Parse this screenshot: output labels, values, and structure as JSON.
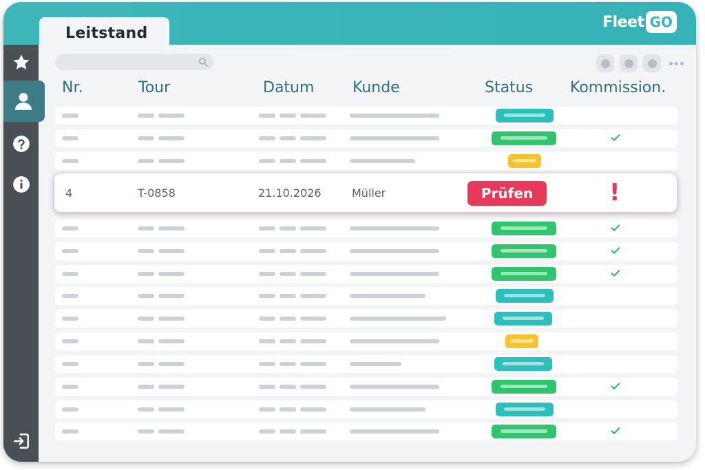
{
  "tab": {
    "label": "Leitstand"
  },
  "logo": {
    "text": "Fleet",
    "badge": "GO"
  },
  "sidebar": {
    "items": [
      {
        "name": "star-icon",
        "active": false
      },
      {
        "name": "user-icon",
        "active": true
      },
      {
        "name": "help-icon",
        "active": false
      },
      {
        "name": "info-icon",
        "active": false
      },
      {
        "name": "logout-icon",
        "active": false
      }
    ]
  },
  "table": {
    "columns": [
      "Nr.",
      "Tour",
      "Datum",
      "Kunde",
      "Status",
      "Kommission."
    ],
    "highlighted_row": {
      "nr": "4",
      "tour": "T-0858",
      "datum": "21.10.2026",
      "kunde": "Müller",
      "status": "Prüfen",
      "kommission": "!"
    },
    "placeholder_rows": [
      {
        "status": "teal",
        "checked": false
      },
      {
        "status": "green",
        "checked": true
      },
      {
        "status": "yellow",
        "checked": false
      },
      {
        "status": "highlight"
      },
      {
        "status": "green",
        "checked": true
      },
      {
        "status": "green",
        "checked": true
      },
      {
        "status": "green",
        "checked": true
      },
      {
        "status": "teal",
        "checked": false
      },
      {
        "status": "teal",
        "checked": false
      },
      {
        "status": "yellow",
        "checked": false
      },
      {
        "status": "teal",
        "checked": false
      },
      {
        "status": "green",
        "checked": true
      },
      {
        "status": "teal",
        "checked": false
      },
      {
        "status": "green",
        "checked": true
      }
    ]
  },
  "colors": {
    "accent": "#3fb6ba",
    "sidebar": "#4a4f56",
    "teal": "#2cc0bd",
    "green": "#2fc56d",
    "yellow": "#f5c32c",
    "alert": "#e8395a",
    "check": "#27b35e"
  }
}
